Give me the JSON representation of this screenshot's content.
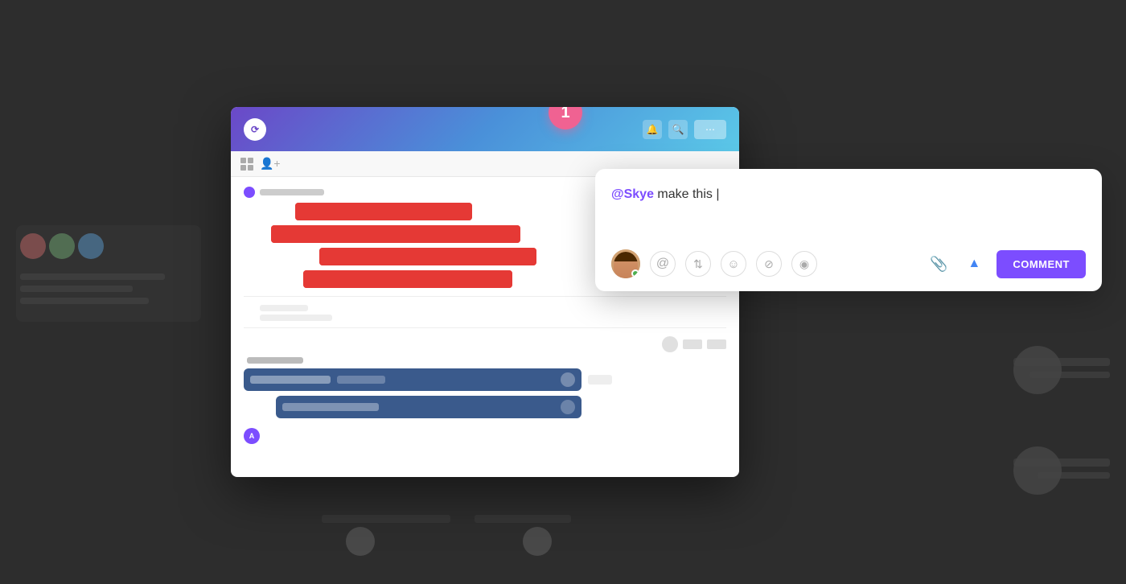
{
  "background": {
    "color": "#2d2d2d"
  },
  "notification_badge": {
    "number": "1"
  },
  "comment_popup": {
    "mention": "@Skye",
    "text": " make this |",
    "submit_label": "COMMENT",
    "avatar_alt": "User avatar with online indicator"
  },
  "toolbar_icons": {
    "at_sign": "@",
    "arrows": "⇅",
    "emoji": "☺",
    "slash": "⊘",
    "circle": "◎",
    "attach": "🖇",
    "drive": "▲"
  },
  "app_header": {
    "logo": "⟳"
  },
  "gantt": {
    "red_section_label": "",
    "blue_section_label": "",
    "bars": {
      "red": [
        "short",
        "long",
        "medium",
        "medium2"
      ],
      "blue": [
        "wide",
        "medium"
      ]
    }
  }
}
